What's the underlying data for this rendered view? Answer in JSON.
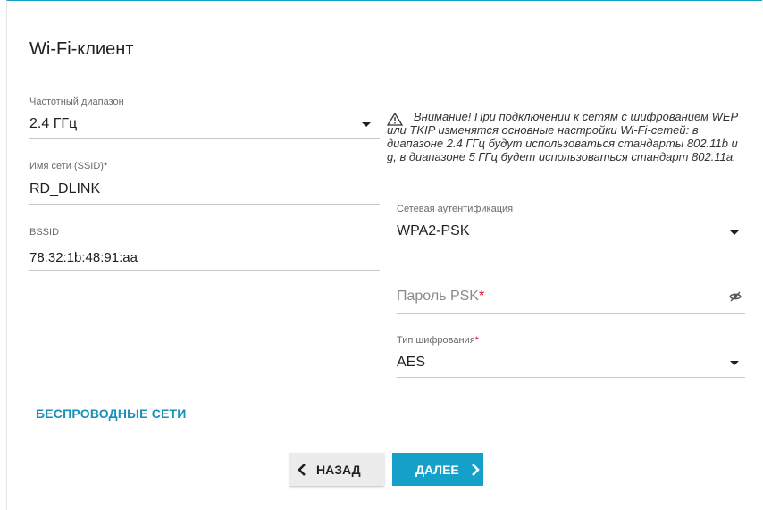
{
  "page": {
    "title": "Wi-Fi-клиент"
  },
  "form": {
    "band": {
      "label": "Частотный диапазон",
      "value": "2.4 ГГц"
    },
    "ssid": {
      "label": "Имя сети (SSID)",
      "required_mark": "*",
      "value": "RD_DLINK"
    },
    "bssid": {
      "label": "BSSID",
      "value": "78:32:1b:48:91:aa"
    },
    "auth": {
      "label": "Сетевая аутентификация",
      "value": "WPA2-PSK"
    },
    "psk": {
      "placeholder": "Пароль PSK",
      "required_mark": "*"
    },
    "cipher": {
      "label": "Тип шифрования",
      "required_mark": "*",
      "value": "AES"
    }
  },
  "warning": {
    "icon": "warning-triangle-icon",
    "text": "Внимание! При подключении к сетям с шифрованием WEP или TKIP изменятся основные настройки Wi-Fi-сетей: в диапазоне 2.4 ГГц будут использоваться стандарты 802.11b и g, в диапазоне 5 ГГц будет использоваться стандарт 802.11a."
  },
  "links": {
    "wireless_networks": "БЕСПРОВОДНЫЕ СЕТИ"
  },
  "buttons": {
    "back": "НАЗАД",
    "next": "ДАЛЕЕ"
  },
  "colors": {
    "accent": "#14a0c8",
    "link": "#1a8fb8",
    "required": "#d0021b"
  }
}
